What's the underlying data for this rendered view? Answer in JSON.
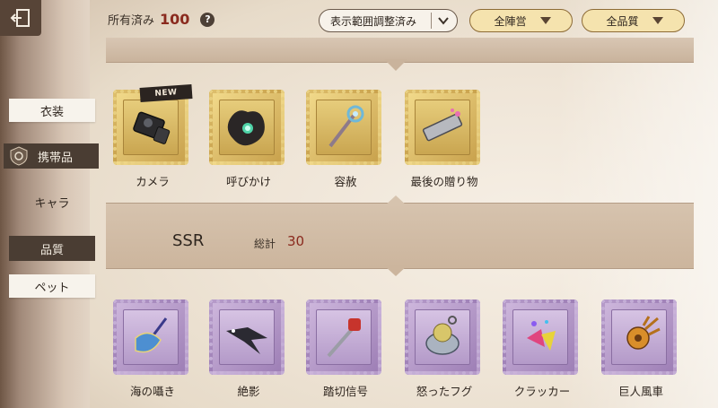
{
  "topbar": {
    "owned_label": "所有済み",
    "owned_count": "100",
    "help": "?",
    "filter_range": "表示範囲調整済み",
    "filter_camp": "全陣営",
    "filter_quality": "全品質"
  },
  "sidebar": {
    "items": [
      {
        "label": "衣装"
      },
      {
        "label": "携帯品"
      },
      {
        "label": "キャラ"
      },
      {
        "label": "品質"
      },
      {
        "label": "ペット"
      }
    ]
  },
  "top_items": [
    {
      "label": "カメラ",
      "icon": "camera-icon"
    },
    {
      "label": "呼びかけ",
      "icon": "dark-orb-icon"
    },
    {
      "label": "容赦",
      "icon": "staff-icon"
    },
    {
      "label": "最後の贈り物",
      "icon": "harmonica-icon"
    }
  ],
  "section": {
    "title": "SSR",
    "total_label": "総計",
    "total_value": "30"
  },
  "ssr_items": [
    {
      "label": "海の囁き",
      "icon": "shell-wand-icon"
    },
    {
      "label": "絶影",
      "icon": "bird-icon"
    },
    {
      "label": "踏切信号",
      "icon": "signal-wand-icon"
    },
    {
      "label": "怒ったフグ",
      "icon": "pufferfish-icon"
    },
    {
      "label": "クラッカー",
      "icon": "cracker-icon"
    },
    {
      "label": "巨人風車",
      "icon": "windmill-icon"
    }
  ],
  "new_tag": "NEW",
  "colors": {
    "accent_red": "#8a2a1e",
    "gold_frame": "#e8cf80",
    "purple_frame": "#c4aed6",
    "dark_tab": "#4a3d33"
  }
}
